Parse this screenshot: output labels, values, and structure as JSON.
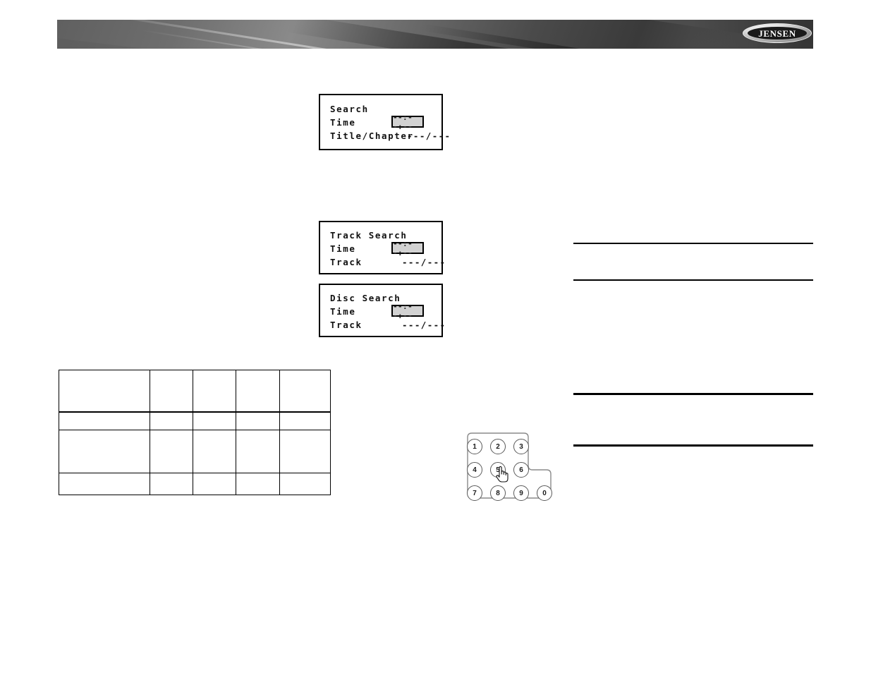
{
  "header": {
    "logo_text": "JENSEN",
    "logo_name": "jensen-logo"
  },
  "osd_panels": [
    {
      "name": "search",
      "title": "Search",
      "time_label": "Time",
      "time_value": "--:--:--",
      "row2_label": "Title/Chapter",
      "row2_value": "---/---"
    },
    {
      "name": "track-search",
      "title": "Track Search",
      "time_label": "Time",
      "time_value": "--:--:--",
      "row2_label": "Track",
      "row2_value": "---/---"
    },
    {
      "name": "disc-search",
      "title": "Disc Search",
      "time_label": "Time",
      "time_value": "--:--:--",
      "row2_label": "Track",
      "row2_value": "---/---"
    }
  ],
  "spec_table": {
    "columns": [
      "",
      "",
      "",
      "",
      ""
    ],
    "rows": [
      [
        "",
        "",
        "",
        "",
        ""
      ],
      [
        "",
        "",
        "",
        "",
        ""
      ],
      [
        "",
        "",
        "",
        "",
        ""
      ],
      [
        "",
        "",
        "",
        "",
        ""
      ]
    ]
  },
  "keypad": {
    "keys": [
      "1",
      "2",
      "3",
      "4",
      "5",
      "6",
      "7",
      "8",
      "9",
      "0"
    ],
    "pressed_key": "5",
    "cursor": "hand-pointer"
  },
  "colors": {
    "banner_dark": "#4c4c4c",
    "banner_light": "#8a8a8a",
    "rule": "#000000",
    "time_box_fill": "#d2d2d2",
    "page_background": "#ffffff"
  }
}
